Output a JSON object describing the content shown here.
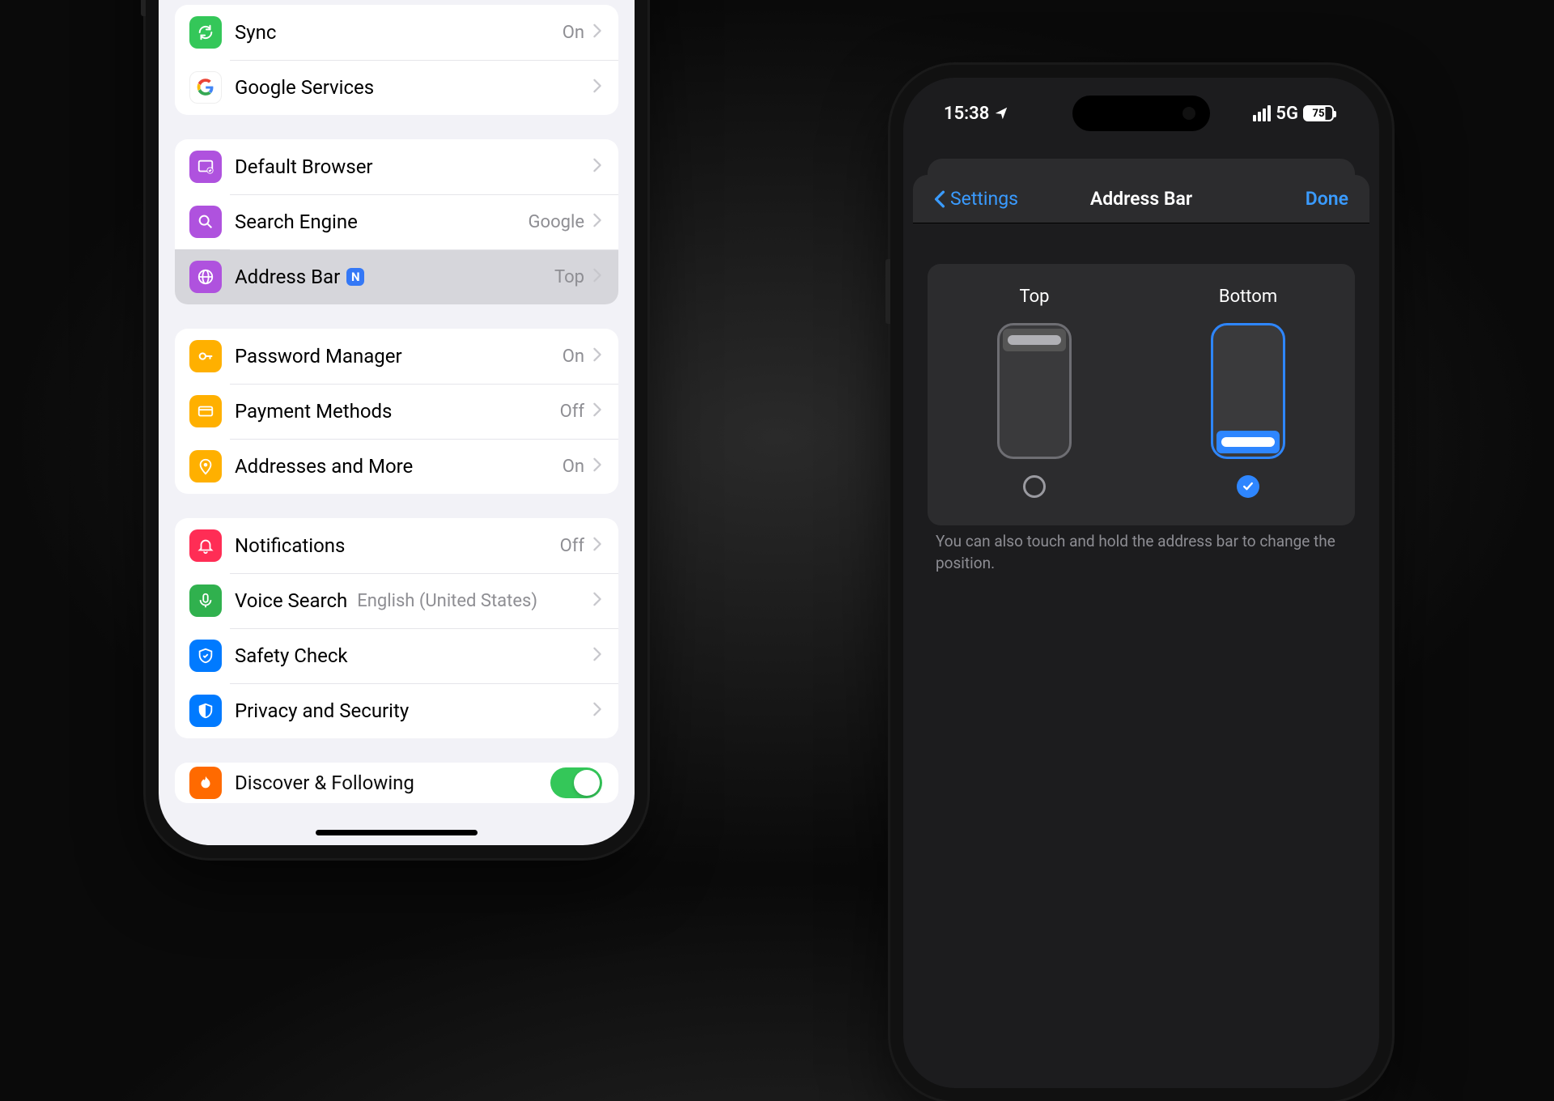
{
  "phone1": {
    "group1": {
      "sync": {
        "label": "Sync",
        "value": "On"
      },
      "google": {
        "label": "Google Services"
      }
    },
    "group2": {
      "default_browser": {
        "label": "Default Browser"
      },
      "search_engine": {
        "label": "Search Engine",
        "value": "Google"
      },
      "address_bar": {
        "label": "Address Bar",
        "value": "Top",
        "badge": "N"
      }
    },
    "group3": {
      "password_manager": {
        "label": "Password Manager",
        "value": "On"
      },
      "payment_methods": {
        "label": "Payment Methods",
        "value": "Off"
      },
      "addresses": {
        "label": "Addresses and More",
        "value": "On"
      }
    },
    "group4": {
      "notifications": {
        "label": "Notifications",
        "value": "Off"
      },
      "voice_search": {
        "label": "Voice Search",
        "value": "English (United States)"
      },
      "safety_check": {
        "label": "Safety Check"
      },
      "privacy": {
        "label": "Privacy and Security"
      }
    },
    "group5": {
      "discover": {
        "label": "Discover & Following"
      }
    }
  },
  "phone2": {
    "status": {
      "time": "15:38",
      "cell": "5G",
      "battery": "75"
    },
    "nav": {
      "back": "Settings",
      "title": "Address Bar",
      "done": "Done"
    },
    "options": {
      "top": "Top",
      "bottom": "Bottom",
      "selected": "bottom"
    },
    "hint": "You can also touch and hold the address bar to change the position."
  }
}
